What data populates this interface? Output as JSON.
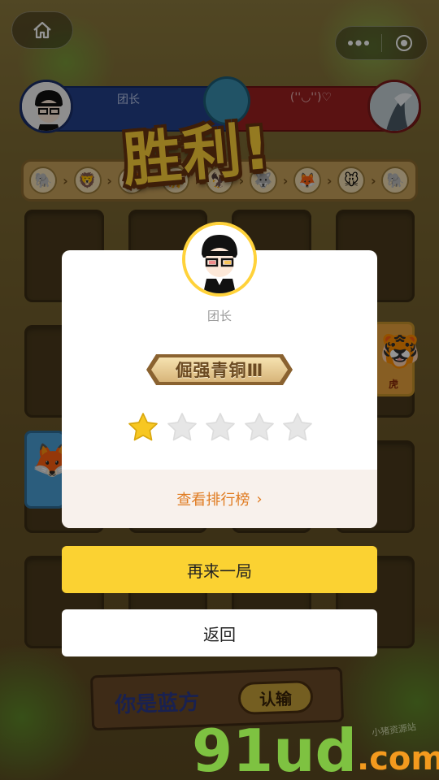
{
  "system": {
    "home_icon": "home-icon",
    "more_icon": "more-dots-icon",
    "close_icon": "target-close-icon"
  },
  "players": {
    "left_name": "团长",
    "right_name": "(''◡'')♡"
  },
  "victory_title": "胜利!",
  "modal": {
    "player_name": "团长",
    "rank_title": "倔强青铜Ⅲ",
    "stars_total": 5,
    "stars_filled": 1,
    "leaderboard_link": "查看排行榜",
    "leaderboard_chevron": "›"
  },
  "buttons": {
    "play_again": "再来一局",
    "back": "返回"
  },
  "bottom_sign": {
    "side_text": "你是蓝方",
    "surrender": "认输"
  },
  "side_card": {
    "label": "虎"
  },
  "watermark": {
    "main": "91ud",
    "suffix": ".com",
    "small": "小猪资源站"
  },
  "colors": {
    "accent_yellow": "#fbd232",
    "link_orange": "#e07c22",
    "star_gold": "#f7c722",
    "star_empty": "#e6e6e6",
    "team_blue": "#24408a",
    "team_red": "#9c1f1f"
  }
}
